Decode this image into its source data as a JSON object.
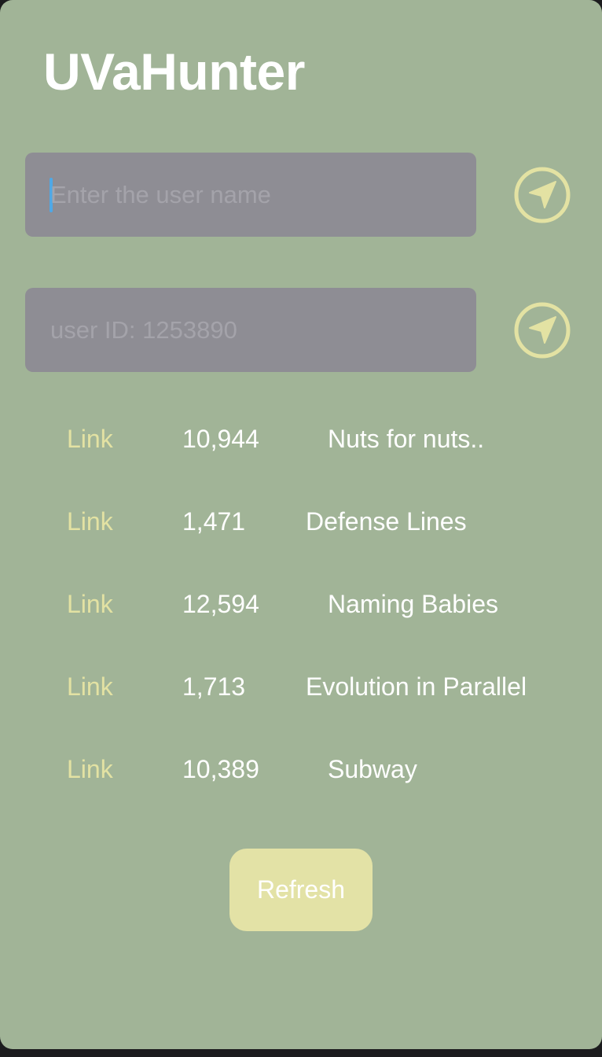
{
  "app": {
    "title": "UVaHunter"
  },
  "search": {
    "username_placeholder": "Enter the user name",
    "userid_placeholder": "user ID: 1253890"
  },
  "icons": {
    "go_button_icon": "navigation-arrow-icon",
    "accent_color": "#e3e2a3"
  },
  "problems": [
    {
      "link": "Link",
      "count": "10,944",
      "name": "Nuts for nuts.."
    },
    {
      "link": "Link",
      "count": "1,471",
      "name": "Defense Lines"
    },
    {
      "link": "Link",
      "count": "12,594",
      "name": "Naming Babies"
    },
    {
      "link": "Link",
      "count": "1,713",
      "name": "Evolution in Parallel"
    },
    {
      "link": "Link",
      "count": "10,389",
      "name": "Subway"
    }
  ],
  "actions": {
    "refresh_label": "Refresh"
  }
}
